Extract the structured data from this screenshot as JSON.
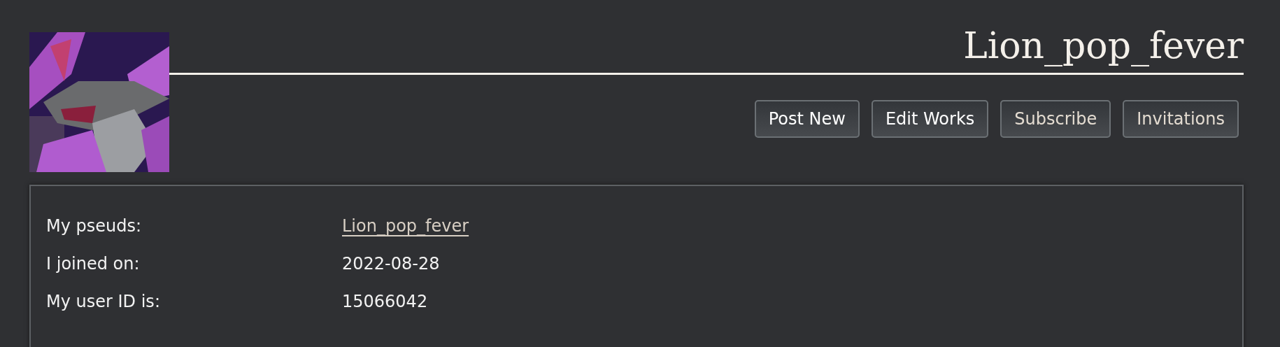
{
  "header": {
    "title": "Lion_pop_fever"
  },
  "actions": [
    {
      "label": "Post New",
      "kind": "primary"
    },
    {
      "label": "Edit Works",
      "kind": "primary"
    },
    {
      "label": "Subscribe",
      "kind": "secondary"
    },
    {
      "label": "Invitations",
      "kind": "secondary"
    }
  ],
  "profile": [
    {
      "label": "My pseuds:",
      "value": "Lion_pop_fever",
      "kind": "link"
    },
    {
      "label": "I joined on:",
      "value": "2022-08-28",
      "kind": "text"
    },
    {
      "label": "My user ID is:",
      "value": "15066042",
      "kind": "text"
    }
  ]
}
